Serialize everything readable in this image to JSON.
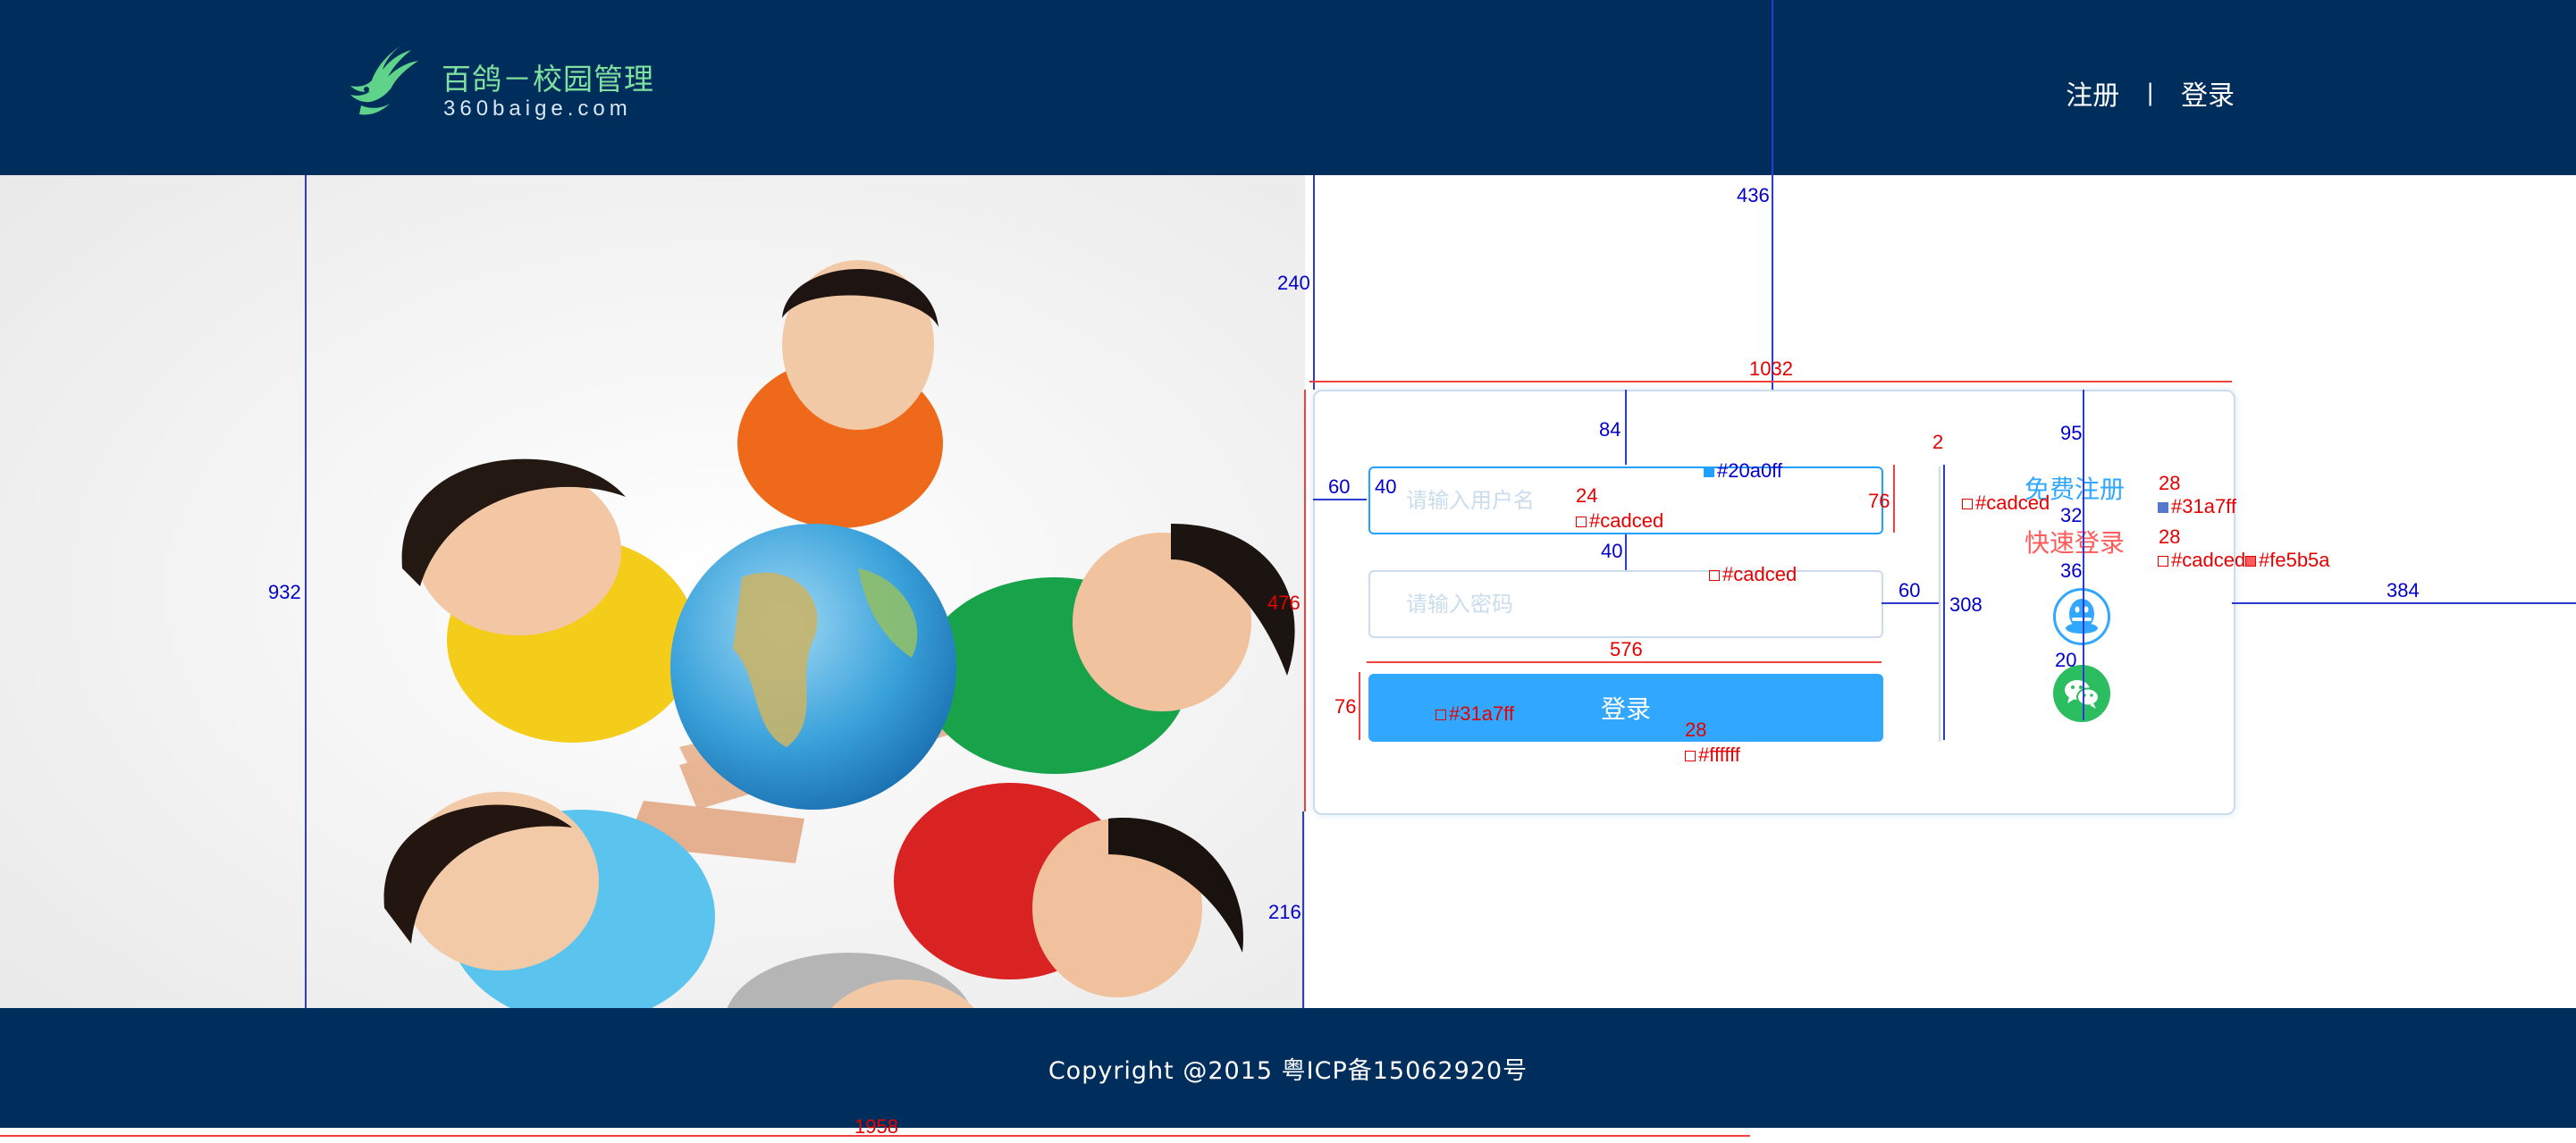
{
  "header": {
    "logo_title": "百鸽－校园管理",
    "logo_sub": "360baige.com",
    "nav_register": "注册",
    "nav_separator": "|",
    "nav_login": "登录"
  },
  "login": {
    "username_placeholder": "请输入用户名",
    "password_placeholder": "请输入密码",
    "login_button": "登录",
    "register_link": "免费注册",
    "quick_login_link": "快速登录"
  },
  "social": {
    "qq_icon": "qq-penguin-icon",
    "wechat_icon": "wechat-icon"
  },
  "footer": {
    "copyright": "Copyright @2015 粤ICP备15062920号"
  },
  "colors": {
    "header_bg": "#002e5c",
    "focus_border": "#20a0ff",
    "border": "#cadced",
    "primary": "#31a7ff",
    "accent_red": "#fe5b5a",
    "button_text": "#ffffff"
  },
  "annotations": {
    "header_offset": "436",
    "card_width": "1032",
    "left_offset": "240",
    "top_84": "84",
    "pad_60": "60",
    "pad_40": "40",
    "focus_color": "#20a0ff",
    "fs_24": "24",
    "border_color_1": "#cadced",
    "input_h_76": "76",
    "gap_40": "40",
    "border_color_2": "#cadced",
    "card_height": "476",
    "field_w_576": "576",
    "btn_h_76": "76",
    "btn_color": "#31a7ff",
    "fs_28_btn": "28",
    "btn_text_color": "#ffffff",
    "hero_height": "932",
    "bottom_216": "216",
    "divider_w_2": "2",
    "divider_color": "#cadced",
    "gap_60": "60",
    "divider_h_308": "308",
    "top_95": "95",
    "fs_28_reg": "28",
    "reg_color": "#31a7ff",
    "gap_32": "32",
    "fs_28_quick": "28",
    "quick_color_1": "#cadced",
    "quick_color_2": "#fe5b5a",
    "gap_36": "36",
    "gap_20": "20",
    "right_384": "384",
    "footer_1958": "1958"
  }
}
